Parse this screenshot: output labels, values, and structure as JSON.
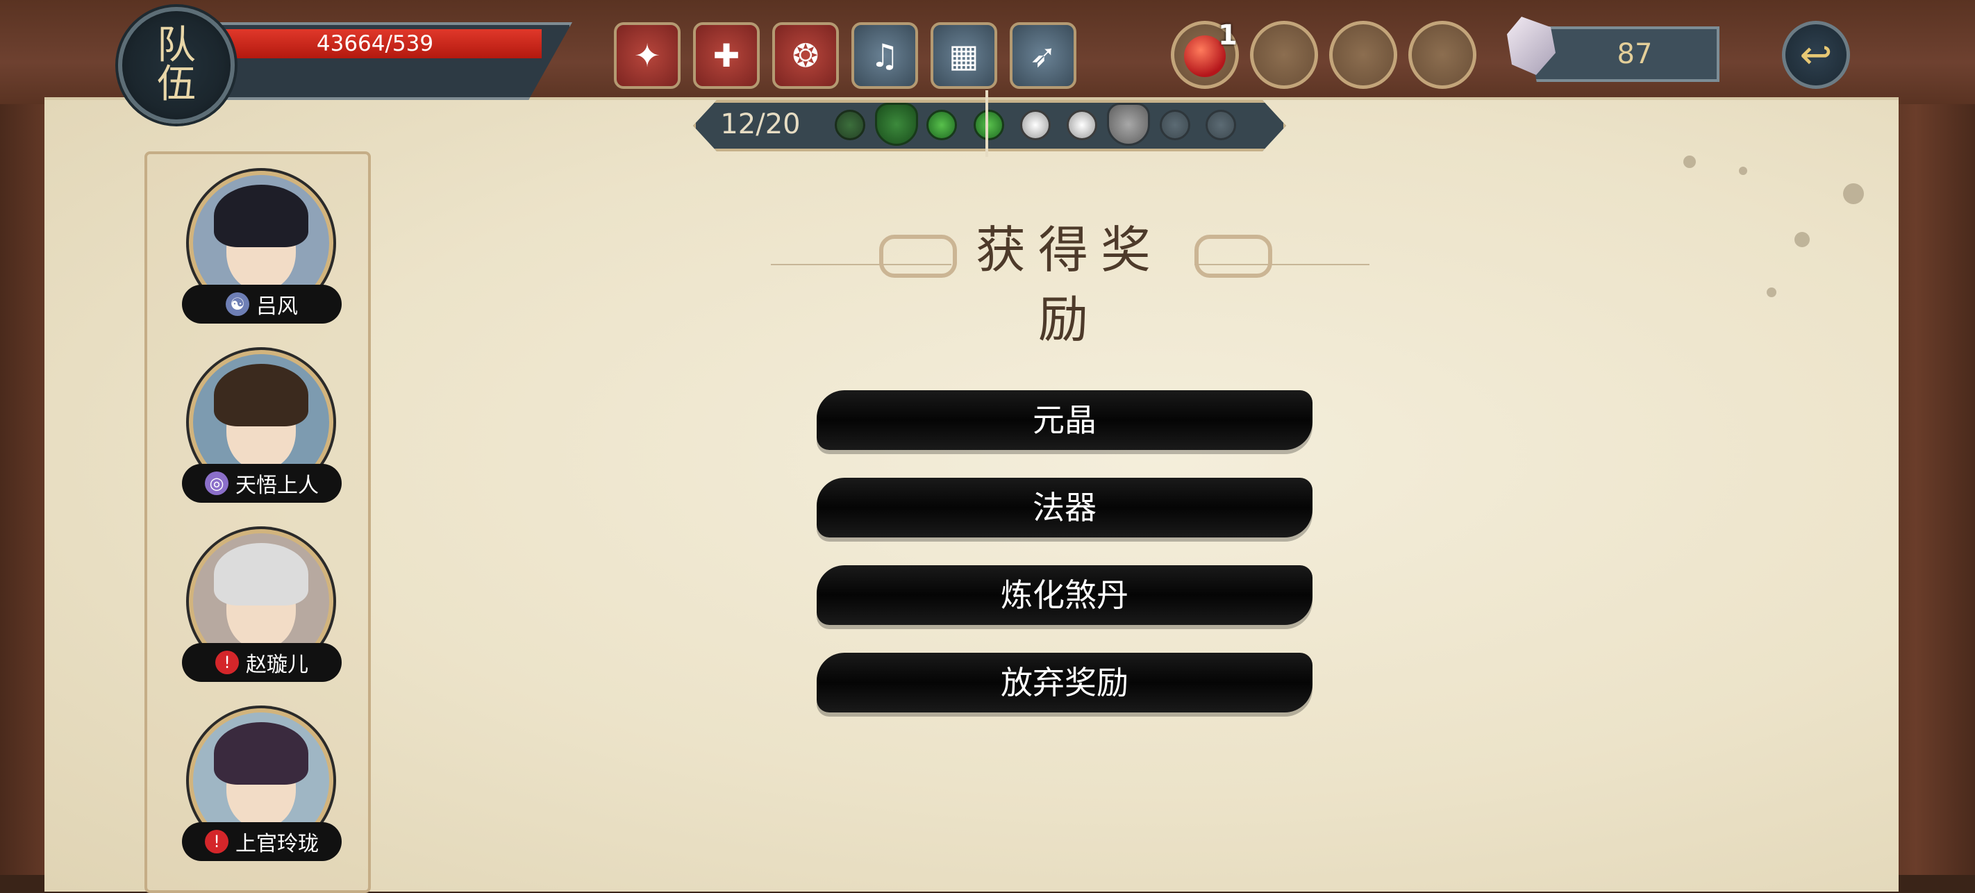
{
  "header": {
    "team_label": "队伍",
    "hp_text": "43664/539",
    "skills": [
      "skill-icon-1",
      "skill-icon-2",
      "skill-icon-3",
      "bell-icon",
      "pagoda-icon",
      "bird-icon"
    ],
    "item_slots": [
      {
        "icon": "potion-icon",
        "count": "1"
      },
      {
        "icon": "empty-slot"
      },
      {
        "icon": "empty-slot"
      },
      {
        "icon": "empty-slot"
      }
    ],
    "crystal_count": "87"
  },
  "progress": {
    "label": "12/20",
    "nodes": [
      "dimgreen",
      "boss-green",
      "green",
      "green",
      "white",
      "white",
      "boss-grey",
      "grey",
      "grey"
    ]
  },
  "party": {
    "members": [
      {
        "name": "吕风",
        "element_color": "#6e7fb5"
      },
      {
        "name": "天悟上人",
        "element_color": "#8b6fc9"
      },
      {
        "name": "赵璇儿",
        "element_color": "#d4262a"
      },
      {
        "name": "上官玲珑",
        "element_color": "#d4262a"
      }
    ]
  },
  "reward": {
    "title": "获得奖励",
    "options": [
      "元晶",
      "法器",
      "炼化煞丹",
      "放弃奖励"
    ]
  },
  "colors": {
    "paper": "#ece3c9",
    "hp_red": "#c5231a",
    "gold": "#c7b28a",
    "button_black": "#0a0a0a"
  }
}
